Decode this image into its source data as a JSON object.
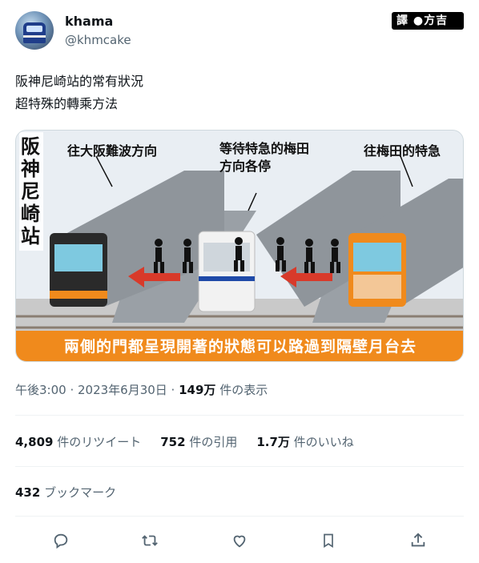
{
  "user": {
    "name": "khama",
    "handle": "@khmcake"
  },
  "badge": {
    "text": "譯 ●方吉君"
  },
  "tweet": {
    "line1": "阪神尼崎站的常有狀況",
    "line2": "超特殊的轉乘方法"
  },
  "image": {
    "station": "阪神尼崎站",
    "label_left": "往大阪難波方向",
    "label_mid1": "等待特急的梅田",
    "label_mid2": "方向各停",
    "label_right": "往梅田的特急",
    "caption": "兩側的門都呈現開著的狀態可以路過到隔壁月台去"
  },
  "meta": {
    "time": "午後3:00 · 2023年6月30日 · ",
    "views_count": "149万",
    "views_label": " 件の表示"
  },
  "stats": {
    "retweets_count": "4,809",
    "retweets_label": " 件のリツイート",
    "quotes_count": "752",
    "quotes_label": " 件の引用",
    "likes_count": "1.7万",
    "likes_label": " 件のいいね"
  },
  "bookmarks": {
    "count": "432",
    "label": " ブックマーク"
  },
  "colors": {
    "text": "#0f1419",
    "muted": "#536471",
    "accent_orange": "#f08a1c",
    "arrow_red": "#d83a2a"
  }
}
